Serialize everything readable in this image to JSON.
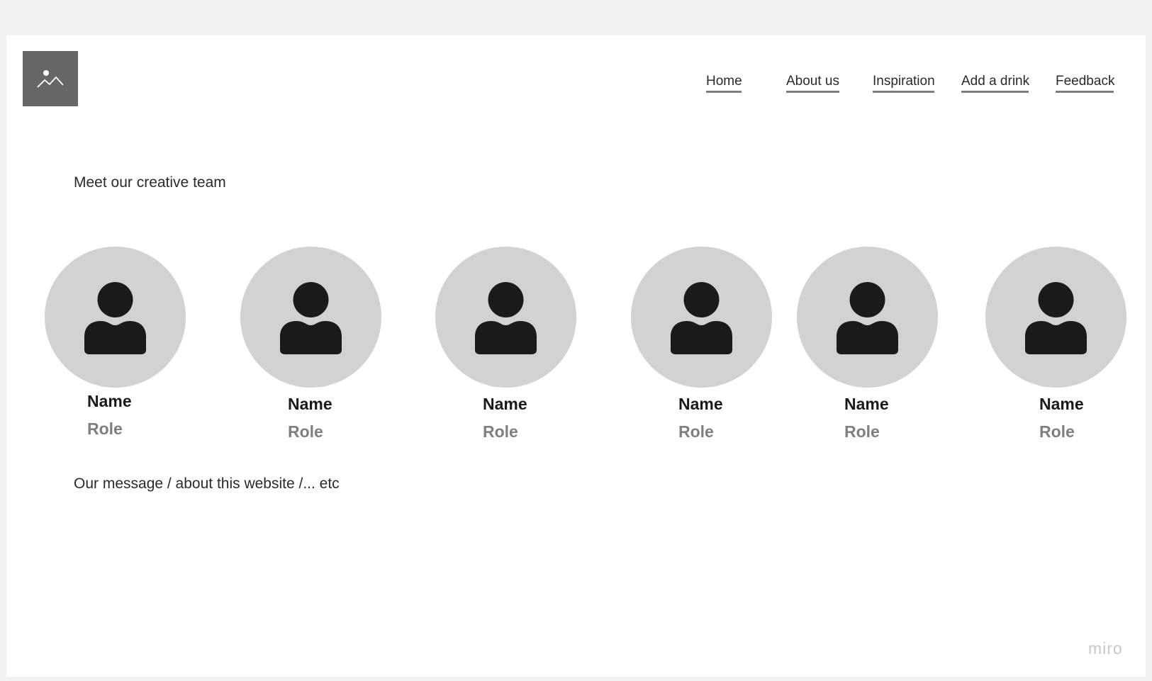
{
  "logo": {
    "icon": "image-placeholder-icon",
    "color": "#666666"
  },
  "nav": {
    "items": [
      {
        "label": "Home"
      },
      {
        "label": "About us"
      },
      {
        "label": "Inspiration"
      },
      {
        "label": "Add a drink"
      },
      {
        "label": "Feedback"
      }
    ]
  },
  "team": {
    "title": "Meet our creative team",
    "members": [
      {
        "name": "Name",
        "role": "Role",
        "icon": "user-icon"
      },
      {
        "name": "Name",
        "role": "Role",
        "icon": "user-icon"
      },
      {
        "name": "Name",
        "role": "Role",
        "icon": "user-icon"
      },
      {
        "name": "Name",
        "role": "Role",
        "icon": "user-icon"
      },
      {
        "name": "Name",
        "role": "Role",
        "icon": "user-icon"
      },
      {
        "name": "Name",
        "role": "Role",
        "icon": "user-icon"
      }
    ]
  },
  "message": "Our message / about this website /... etc",
  "watermark": "miro",
  "colors": {
    "canvas": "#f2f2f2",
    "page": "#ffffff",
    "avatar_bg": "#d2d2d2",
    "avatar_icon": "#1a1a1a",
    "role_text": "#7f7f7f",
    "nav_underline": "#808080"
  }
}
